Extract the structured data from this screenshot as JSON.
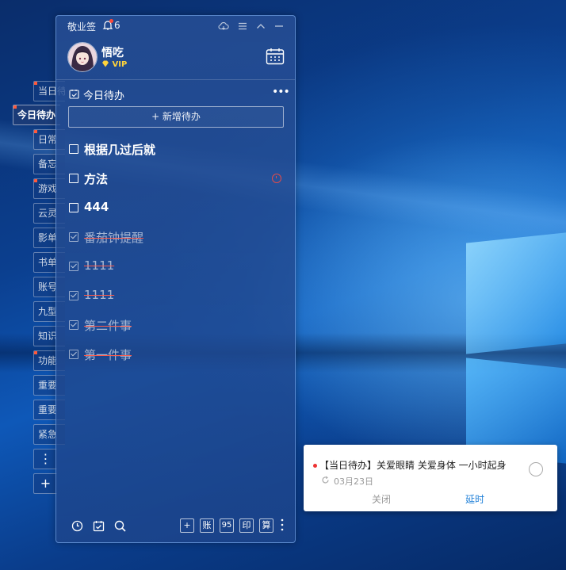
{
  "app": {
    "title": "敬业签",
    "notification_count": "6"
  },
  "user": {
    "name": "悟吃",
    "badge": "VIP"
  },
  "side_tabs": [
    {
      "label": "当日待办",
      "marked": true,
      "active": false
    },
    {
      "label": "今日待办",
      "marked": true,
      "active": true
    },
    {
      "label": "日常",
      "marked": true,
      "active": false
    },
    {
      "label": "备忘",
      "marked": false,
      "active": false
    },
    {
      "label": "游戏",
      "marked": true,
      "active": false
    },
    {
      "label": "云灵",
      "marked": false,
      "active": false
    },
    {
      "label": "影单",
      "marked": false,
      "active": false
    },
    {
      "label": "书单",
      "marked": false,
      "active": false
    },
    {
      "label": "账号",
      "marked": false,
      "active": false
    },
    {
      "label": "九型",
      "marked": false,
      "active": false
    },
    {
      "label": "知识",
      "marked": false,
      "active": false
    },
    {
      "label": "功能",
      "marked": true,
      "active": false
    },
    {
      "label": "重要",
      "marked": false,
      "active": false
    },
    {
      "label": "重要",
      "marked": false,
      "active": false
    },
    {
      "label": "紧急",
      "marked": false,
      "active": false
    }
  ],
  "side_more_icon": "⋮",
  "side_add_icon": "+",
  "list": {
    "title": "今日待办",
    "more": "•••",
    "add_button": "+ 新增待办",
    "tasks": [
      {
        "text": "根据几过后就",
        "done": false,
        "alarm": false
      },
      {
        "text": "方法",
        "done": false,
        "alarm": true
      },
      {
        "text": "444",
        "done": false,
        "alarm": false
      },
      {
        "text": "番茄钟提醒",
        "done": true,
        "alarm": false
      },
      {
        "text": "1111",
        "done": true,
        "alarm": false
      },
      {
        "text": "1111",
        "done": true,
        "alarm": false
      },
      {
        "text": "第二件事",
        "done": true,
        "alarm": false
      },
      {
        "text": "第一件事",
        "done": true,
        "alarm": false
      }
    ]
  },
  "toolbar": {
    "buttons": [
      "+",
      "账",
      "95",
      "印",
      "算"
    ]
  },
  "popup": {
    "message": "【当日待办】关爱眼睛  关爱身体  一小时起身",
    "date": "03月23日",
    "close_label": "关闭",
    "delay_label": "延时"
  },
  "colors": {
    "accent_red": "#ff5a3c",
    "link_blue": "#1e7fd8",
    "vip_gold": "#ffd43b"
  }
}
